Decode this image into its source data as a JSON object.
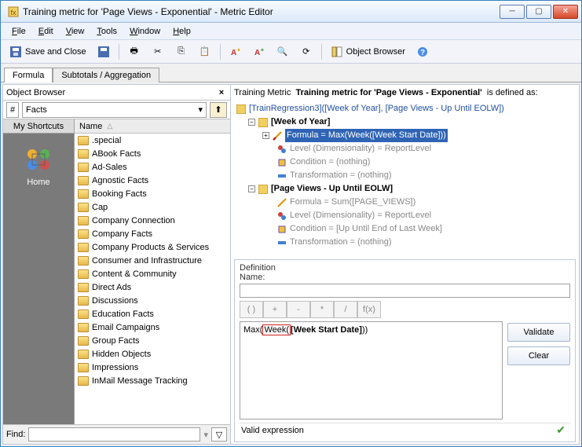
{
  "title": "Training metric for 'Page Views - Exponential' - Metric Editor",
  "menus": {
    "file": "File",
    "edit": "Edit",
    "view": "View",
    "tools": "Tools",
    "window": "Window",
    "help": "Help"
  },
  "toolbar": {
    "save_close": "Save and Close",
    "obj_browser": "Object Browser"
  },
  "tabs": {
    "formula": "Formula",
    "subtotals": "Subtotals / Aggregation"
  },
  "object_browser": {
    "header": "Object Browser",
    "selector_prefix": "#",
    "selector_value": "Facts",
    "shortcuts_hdr": "My Shortcuts",
    "home": "Home",
    "name_col": "Name",
    "folders": [
      ".special",
      "ABook Facts",
      "Ad-Sales",
      "Agnostic Facts",
      "Booking Facts",
      "Cap",
      "Company Connection",
      "Company Facts",
      "Company Products & Services",
      "Consumer and Infrastructure",
      "Content & Community",
      "Direct Ads",
      "Discussions",
      "Education Facts",
      "Email Campaigns",
      "Group Facts",
      "Hidden Objects",
      "Impressions",
      "InMail Message Tracking"
    ],
    "find_label": "Find:"
  },
  "right": {
    "training_metric_label": "Training Metric",
    "metric_name": "Training metric for 'Page Views - Exponential'",
    "defined_as": "is defined as:",
    "tree": {
      "root": "[TrainRegression3]([Week of Year], [Page Views - Up Until EOLW])",
      "g1": "[Week of Year]",
      "g1_formula": "Formula = Max(Week([Week Start Date]))",
      "g1_level": "Level (Dimensionality) = ReportLevel",
      "g1_cond": "Condition = (nothing)",
      "g1_trans": "Transformation = (nothing)",
      "g2": "[Page Views - Up Until EOLW]",
      "g2_formula": "Formula = Sum([PAGE_VIEWS])",
      "g2_level": "Level (Dimensionality) = ReportLevel",
      "g2_cond": "Condition = [Up Until End of Last Week]",
      "g2_trans": "Transformation = (nothing)"
    },
    "definition_label": "Definition",
    "name_label": "Name:",
    "ops": {
      "paren": "( )",
      "plus": "+",
      "minus": "-",
      "mult": "*",
      "div": "/",
      "fx": "f(x)"
    },
    "expr_pre": "Max(",
    "expr_hl": "Week(",
    "expr_bold": "[Week Start Date]",
    "expr_post": "))",
    "validate": "Validate",
    "clear": "Clear",
    "status": "Valid expression"
  }
}
